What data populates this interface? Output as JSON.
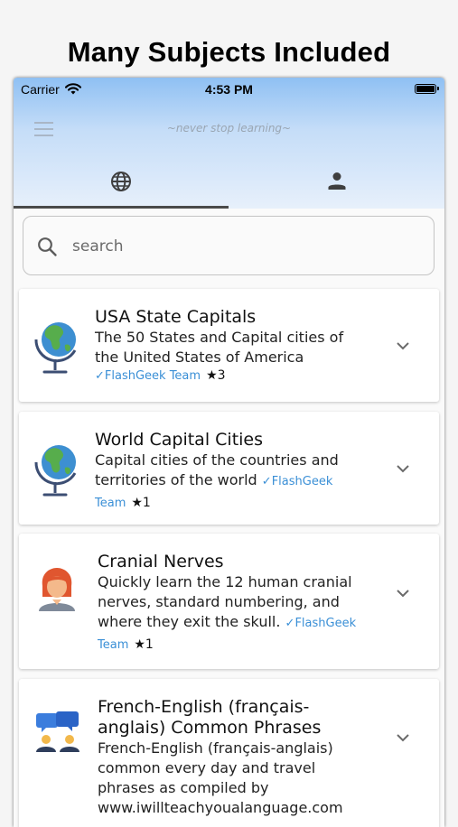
{
  "headline": "Many Subjects Included",
  "status": {
    "carrier": "Carrier",
    "time": "4:53 PM"
  },
  "appbar": {
    "tagline": "~never stop learning~",
    "menu_icon": "hamburger-menu-icon"
  },
  "tabs": [
    {
      "name": "world",
      "icon": "globe-icon",
      "selected": true
    },
    {
      "name": "profile",
      "icon": "person-icon",
      "selected": false
    }
  ],
  "search": {
    "placeholder": "search",
    "value": ""
  },
  "decks": [
    {
      "title": "USA State Capitals",
      "description": "The 50 States and Capital cities of the United States of America",
      "author": "✓FlashGeek Team",
      "stars": "★3",
      "icon": "globe-icon"
    },
    {
      "title": "World Capital Cities",
      "description": "Capital cities of the countries and territories of the world",
      "author": "✓FlashGeek Team",
      "stars": "★1",
      "icon": "globe-icon"
    },
    {
      "title": "Cranial Nerves",
      "description": "Quickly learn the 12 human cranial nerves, standard numbering, and where they exit the skull.",
      "author": "✓FlashGeek Team",
      "stars": "★1",
      "icon": "person-avatar-icon"
    },
    {
      "title": "French-English (français-anglais) Common Phrases",
      "description": "French-English (français-anglais) common every day and travel phrases as compiled by www.iwillteachyoualanguage.com",
      "author": "",
      "stars": "",
      "icon": "conversation-icon"
    }
  ],
  "colors": {
    "accent": "#3a8fd6",
    "appbar_top": "#8fc0f3",
    "appbar_bottom": "#e7f0fb"
  }
}
